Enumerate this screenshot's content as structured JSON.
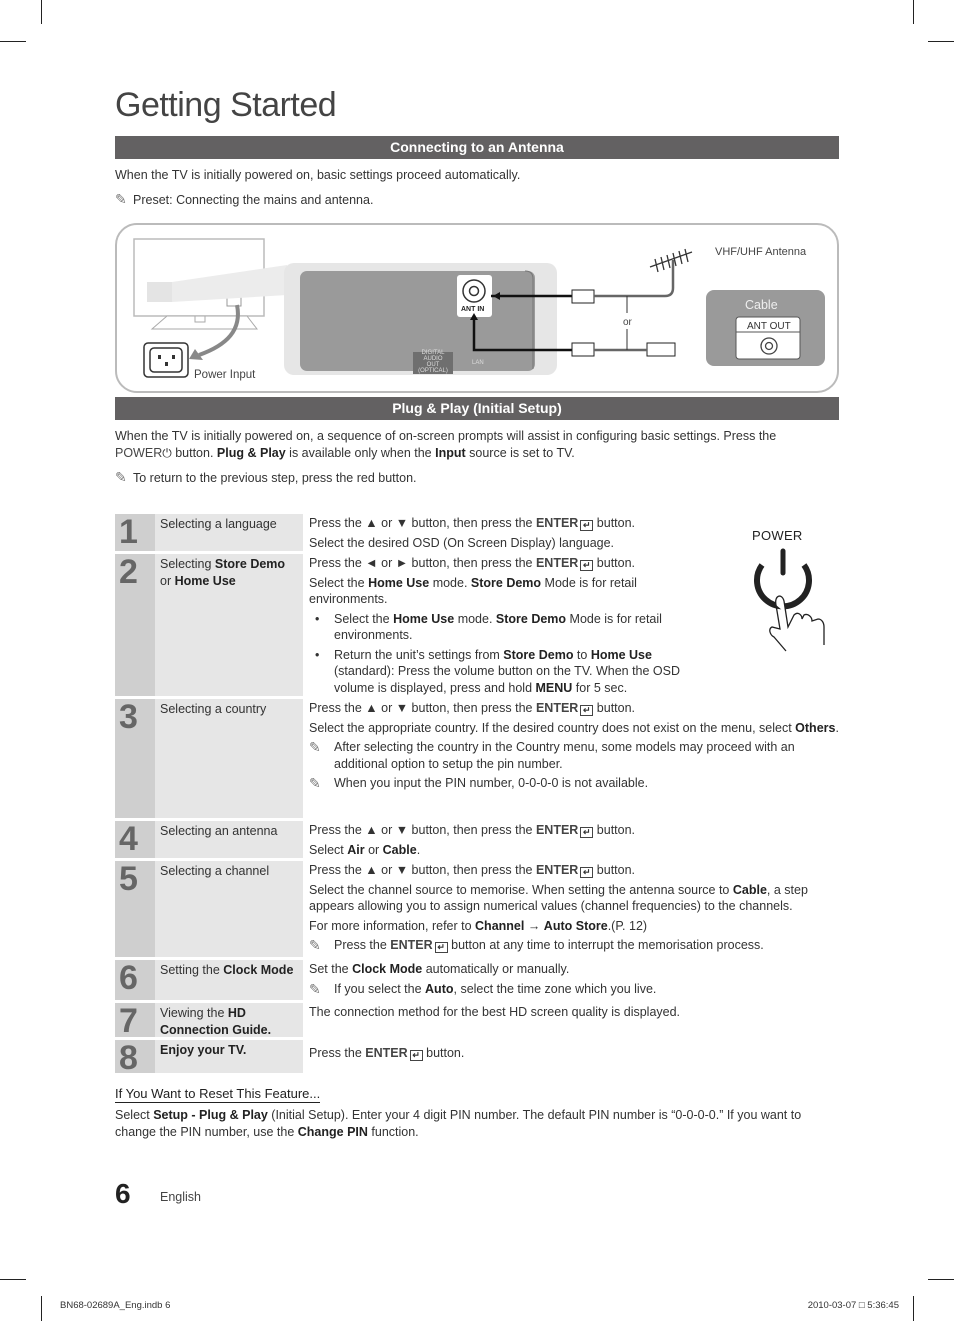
{
  "page": {
    "title": "Getting Started",
    "page_number": "6",
    "language": "English",
    "footer_file": "BN68-02689A_Eng.indb   6",
    "footer_timestamp": "2010-03-07   □ 5:36:45"
  },
  "antenna_section": {
    "heading": "Connecting to an Antenna",
    "intro": "When the TV is initially powered on, basic settings proceed automatically.",
    "note": "Preset: Connecting the mains and antenna.",
    "diagram": {
      "power_input_label": "Power Input",
      "ant_in_label": "ANT IN",
      "digital_audio_label_1": "DIGITAL",
      "digital_audio_label_2": "AUDIO OUT",
      "digital_audio_label_3": "(OPTICAL)",
      "lan_label": "LAN",
      "antenna_label": "VHF/UHF Antenna",
      "or_label": "or",
      "cable_label": "Cable",
      "ant_out_label": "ANT OUT"
    }
  },
  "plug_play_section": {
    "heading": "Plug & Play (Initial Setup)",
    "intro_1": "When the TV is initially powered on, a sequence of on-screen prompts will assist in configuring basic settings. Press the",
    "intro_power": "POWER",
    "intro_2": " button. ",
    "intro_plugplay": "Plug & Play",
    "intro_3": " is available only when the ",
    "intro_input": "Input",
    "intro_4": " source is set to TV.",
    "note": "To return to the previous step, press the red button.",
    "power_illustration_label": "POWER",
    "steps": [
      {
        "number": "1",
        "title": "Selecting a language",
        "lines": [
          "Press the ▲ or ▼ button, then press the ",
          "ENTER",
          " button.",
          "Select the desired OSD (On Screen Display) language."
        ]
      },
      {
        "number": "2",
        "title_pre": "Selecting ",
        "title_b1": "Store Demo",
        "title_mid": " or ",
        "title_b2": "Home Use",
        "line1_pre": "Press the ◄ or ► button, then press the ",
        "line1_enter": "ENTER",
        "line1_post": " button.",
        "line2_pre": "Select the ",
        "line2_b1": "Home Use",
        "line2_mid": " mode. ",
        "line2_b2": "Store Demo",
        "line2_post": " Mode is for retail environments.",
        "bullet1_pre": "Select the ",
        "bullet1_b1": "Home Use",
        "bullet1_mid": " mode. ",
        "bullet1_b2": "Store Demo",
        "bullet1_post": " Mode is for retail environments.",
        "bullet2_pre": "Return the unit’s settings from ",
        "bullet2_b1": "Store Demo",
        "bullet2_mid": " to ",
        "bullet2_b2": "Home Use",
        "bullet2_post": " (standard): Press the volume button on the TV. When the OSD volume is displayed, press and hold ",
        "bullet2_b3": "MENU",
        "bullet2_end": " for 5 sec."
      },
      {
        "number": "3",
        "title": "Selecting a country",
        "line1_pre": "Press the ▲ or ▼ button, then press the ",
        "line1_enter": "ENTER",
        "line1_post": " button.",
        "line2_pre": "Select the appropriate country. If the desired country does not exist on the menu, select ",
        "line2_b": "Others",
        "line2_post": ".",
        "note1": "After selecting the country in the Country menu, some models may proceed with an additional option to setup the pin number.",
        "note2": "When you input the PIN number, 0-0-0-0 is not available."
      },
      {
        "number": "4",
        "title": "Selecting an antenna",
        "line1_pre": "Press the ▲ or ▼ button, then press the ",
        "line1_enter": "ENTER",
        "line1_post": " button.",
        "line2_pre": "Select ",
        "line2_b1": "Air",
        "line2_mid": " or ",
        "line2_b2": "Cable",
        "line2_post": "."
      },
      {
        "number": "5",
        "title": "Selecting a channel",
        "line1_pre": "Press the ▲ or ▼ button, then press the ",
        "line1_enter": "ENTER",
        "line1_post": " button.",
        "line2_pre": "Select the channel source to memorise. When setting the antenna source to ",
        "line2_b": "Cable",
        "line2_post": ", a step appears allowing you to assign numerical values (channel frequencies) to the channels.",
        "line3_pre": "For more information, refer to ",
        "line3_b1": "Channel",
        "line3_arrow": " → ",
        "line3_b2": "Auto Store",
        "line3_post": ".(P. 12)",
        "note_pre": "Press the ",
        "note_enter": "ENTER",
        "note_post": " button at any time to interrupt the memorisation process."
      },
      {
        "number": "6",
        "title_pre": "Setting the ",
        "title_b": "Clock Mode",
        "line1_pre": "Set the ",
        "line1_b": "Clock Mode",
        "line1_post": " automatically or manually.",
        "note_pre": "If you select the ",
        "note_b": "Auto",
        "note_post": ", select the time zone which you live."
      },
      {
        "number": "7",
        "title_pre": "Viewing the ",
        "title_b": "HD Connection Guide.",
        "line1": "The connection method for the best HD screen quality is displayed."
      },
      {
        "number": "8",
        "title_b": "Enjoy your TV.",
        "line1_pre": "Press the ",
        "line1_enter": "ENTER",
        "line1_post": " button."
      }
    ]
  },
  "reset_section": {
    "heading": "If You Want to Reset This Feature...",
    "text_1": "Select ",
    "text_b1": "Setup - Plug & Play",
    "text_2": " (Initial Setup). Enter your 4 digit PIN number. The default PIN number is “0-0-0-0.” If you want to change the PIN number, use the ",
    "text_b2": "Change PIN",
    "text_3": " function."
  },
  "colors": {
    "section_bar": "#636162",
    "step_number_bg": "#cfcfcf",
    "step_title_bg": "#e6e6e6",
    "diagram_panel": "#9a9a9a"
  }
}
